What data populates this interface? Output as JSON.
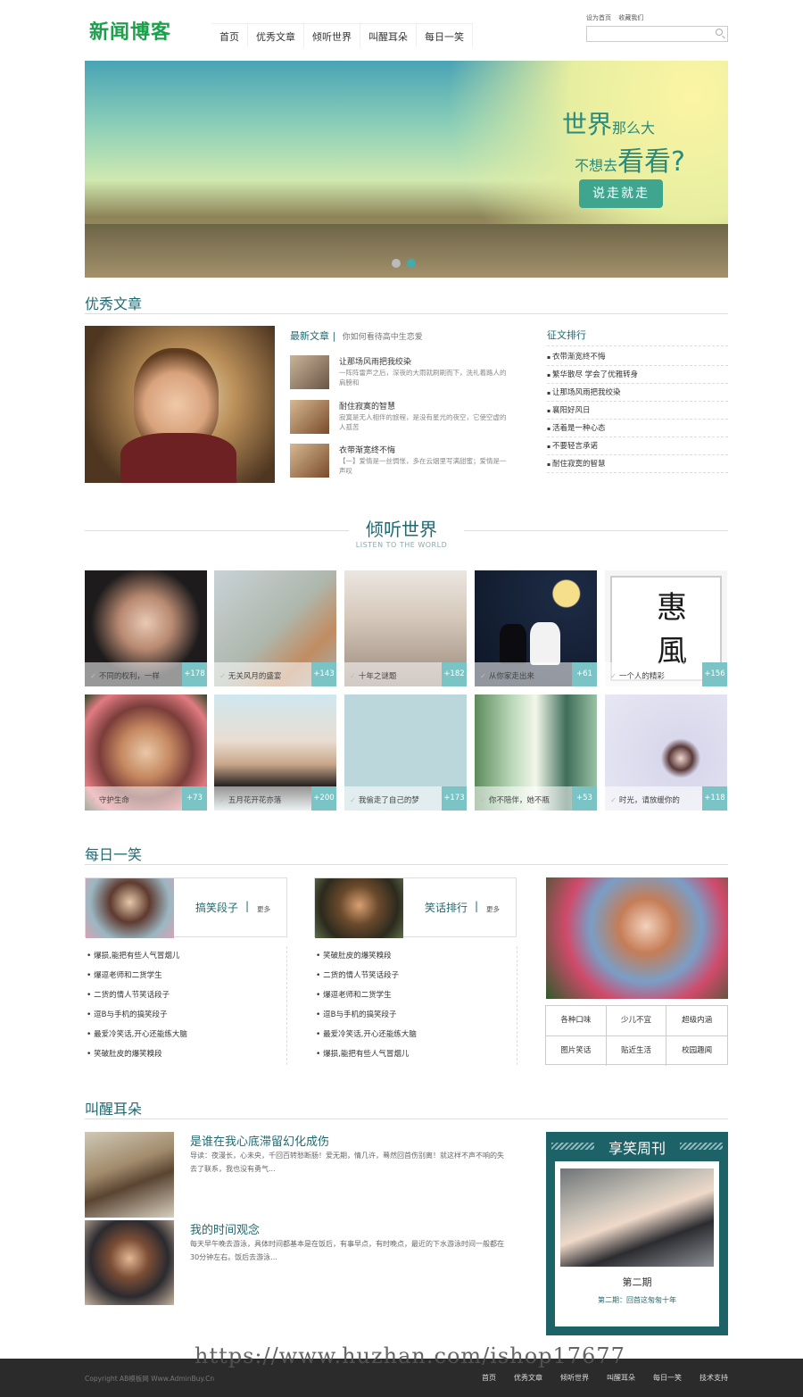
{
  "header": {
    "logo": "新闻博客",
    "nav": [
      "首页",
      "优秀文章",
      "倾听世界",
      "叫醒耳朵",
      "每日一笑"
    ],
    "toplinks": [
      "设为首页",
      "收藏我们"
    ],
    "search_placeholder": ""
  },
  "banner": {
    "line1_big": "世界",
    "line1_small": "那么大",
    "line2_small": "不想去",
    "line2_big": "看看?",
    "button": "说走就走",
    "dots": 2
  },
  "featured": {
    "title": "优秀文章",
    "latest_head": "最新文章",
    "latest_sub": "你如何看待高中生恋爱",
    "articles": [
      {
        "title": "让那场风雨把我绞染",
        "desc": "一阵阵雷声之后，深夜的大雨就刷刷而下，洗礼着路人的肩膀和"
      },
      {
        "title": "耐住寂寞的智慧",
        "desc": "寂寞是无人相伴的旅程，是没有星光的夜空，它使空虚的人孤苦"
      },
      {
        "title": "衣带渐宽终不悔",
        "desc": "【一】爱情是一丝惆怅，多在云烟里写满甜蜜；爱情是一声叹"
      }
    ],
    "rank_head": "征文排行",
    "rank": [
      "衣带渐宽终不悔",
      "繁华散尽 学会了优雅转身",
      "让那场风雨把我绞染",
      "襄阳好风日",
      "活着是一种心态",
      "不要轻言承诺",
      "耐住寂寞的智慧"
    ]
  },
  "world": {
    "title": "倾听世界",
    "subtitle": "LISTEN TO THE WORLD",
    "tiles": [
      {
        "label": "不同的权利，一样",
        "count": "+178"
      },
      {
        "label": "无关风月的盛宴",
        "count": "+143"
      },
      {
        "label": "十年之谜题",
        "count": "+182"
      },
      {
        "label": "从你家走出来",
        "count": "+61"
      },
      {
        "label": "一个人的精彩",
        "count": "+156"
      },
      {
        "label": "守护生命",
        "count": "+73"
      },
      {
        "label": "五月花开花亦落",
        "count": "+200"
      },
      {
        "label": "我偷走了自己的梦",
        "count": "+173"
      },
      {
        "label": "你不陪伴，她不瓶",
        "count": "+53"
      },
      {
        "label": "时光，请放缓你的",
        "count": "+118"
      }
    ]
  },
  "daily": {
    "title": "每日一笑",
    "card1": {
      "name": "搞笑段子",
      "more": "更多"
    },
    "card2": {
      "name": "笑话排行",
      "more": "更多"
    },
    "list1": [
      "爆损,能把有些人气冒烟儿",
      "爆逗老师和二货学生",
      "二货的情人节笑话段子",
      "逗B与手机的搞笑段子",
      "最爱冷笑话,开心还能练大脑",
      "笑破肚皮的爆笑糗段"
    ],
    "list2": [
      "笑破肚皮的爆笑糗段",
      "二货的情人节笑话段子",
      "爆逗老师和二货学生",
      "逗B与手机的搞笑段子",
      "最爱冷笑话,开心还能练大脑",
      "爆损,能把有些人气冒烟儿"
    ],
    "cats": [
      "各种口味",
      "少儿不宜",
      "超级内涵",
      "图片笑话",
      "贴近生活",
      "校园趣闻"
    ]
  },
  "wake": {
    "title": "叫醒耳朵",
    "posts": [
      {
        "title": "是谁在我心底滞留幻化成伤",
        "desc": "导读：夜漫长，心未央，千回百转愁断肠！爱无期，情几许，蓦然回首伤别离！就这样不声不响的失去了联系，我也没有勇气..."
      },
      {
        "title": "我的时间观念",
        "desc": "每天早午晚去游泳，具体时间都基本是在饭后，有事早点，有时晚点，最近的下水游泳时间一般都在30分钟左右。饭后去游泳..."
      }
    ],
    "weekly": {
      "title": "享笑周刊",
      "issue": "第二期",
      "sub": "第二期：回首这匆匆十年"
    }
  },
  "footer": {
    "copyright": "Copyright AB模板网 Www.AdminBuy.Cn",
    "links": [
      "首页",
      "优秀文章",
      "倾听世界",
      "叫醒耳朵",
      "每日一笑",
      "技术支持"
    ]
  },
  "watermark": "https://www.huzhan.com/ishop17677",
  "colors": {
    "accent": "#1f6b71",
    "logo": "#1aa14a",
    "count_badge": "#7bc4c6",
    "footer": "#2b2b2b"
  }
}
